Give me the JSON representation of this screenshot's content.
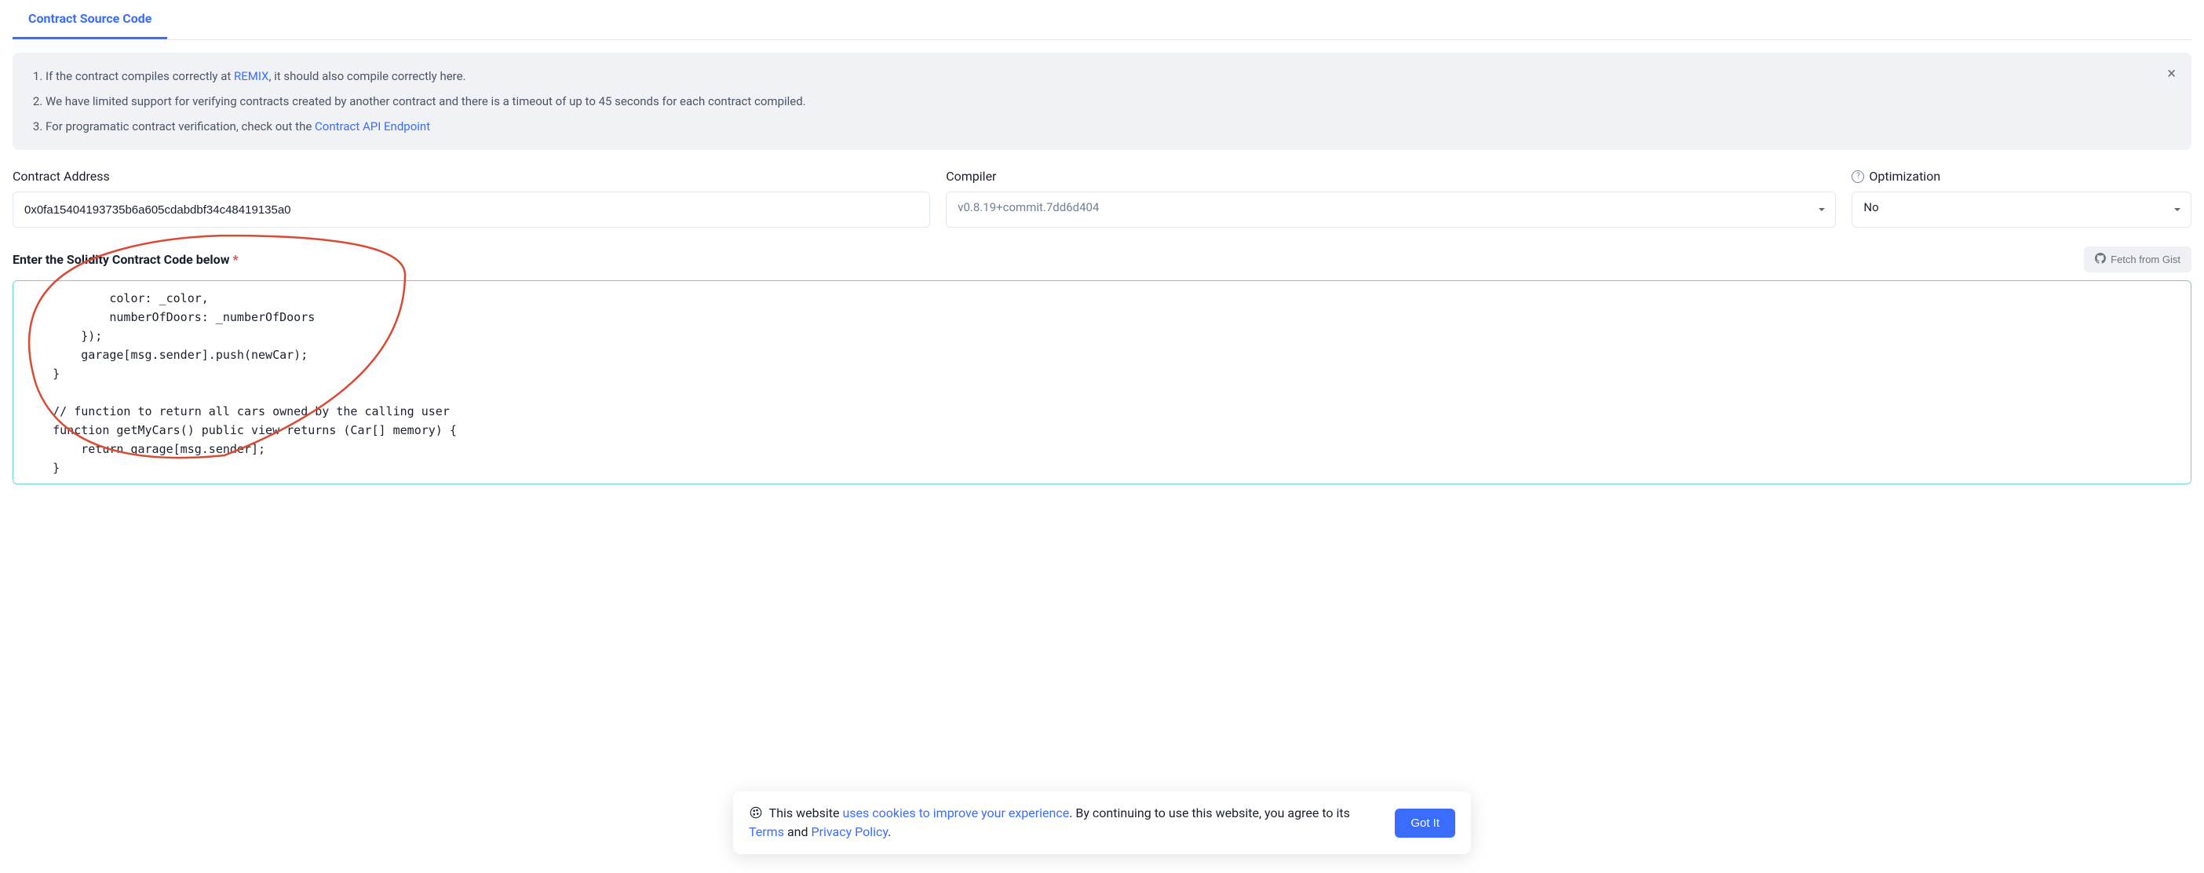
{
  "tab": {
    "label": "Contract Source Code"
  },
  "infobox": {
    "item1_prefix": "If the contract compiles correctly at ",
    "item1_link": "REMIX",
    "item1_suffix": ", it should also compile correctly here.",
    "item2": "We have limited support for verifying contracts created by another contract and there is a timeout of up to 45 seconds for each contract compiled.",
    "item3_prefix": "For programatic contract verification, check out the ",
    "item3_link": "Contract API Endpoint"
  },
  "fields": {
    "address_label": "Contract Address",
    "address_value": "0x0fa15404193735b6a605cdabdbf34c48419135a0",
    "compiler_label": "Compiler",
    "compiler_value": "v0.8.19+commit.7dd6d404",
    "optimization_label": "Optimization",
    "optimization_value": "No"
  },
  "code_section": {
    "label": "Enter the Solidity Contract Code below ",
    "required_mark": "*",
    "gist_label": "Fetch from Gist",
    "code": "            color: _color,\n            numberOfDoors: _numberOfDoors\n        });\n        garage[msg.sender].push(newCar);\n    }\n\n    // function to return all cars owned by the calling user\n    function getMyCars() public view returns (Car[] memory) {\n        return garage[msg.sender];\n    }\n"
  },
  "cookie": {
    "text1": "This website ",
    "link1": "uses cookies to improve your experience",
    "text2": ". By continuing to use this website, you agree to its ",
    "link2": "Terms",
    "text3": " and ",
    "link3": "Privacy Policy",
    "text4": ".",
    "button": "Got It"
  }
}
